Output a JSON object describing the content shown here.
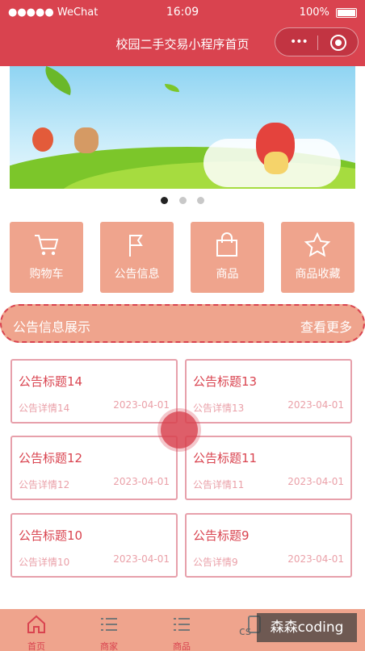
{
  "status": {
    "carrier": "●●●●● WeChat",
    "time": "16:09",
    "battery": "100%"
  },
  "nav": {
    "title": "校园二手交易小程序首页",
    "more_glyph": "•••"
  },
  "banner": {
    "dots": 3,
    "active_dot": 0
  },
  "menu": [
    {
      "label": "购物车",
      "icon": "cart-icon"
    },
    {
      "label": "公告信息",
      "icon": "flag-icon"
    },
    {
      "label": "商品",
      "icon": "bag-icon"
    },
    {
      "label": "商品收藏",
      "icon": "star-icon"
    }
  ],
  "notices_section": {
    "title": "公告信息展示",
    "more": "查看更多"
  },
  "notices": [
    {
      "title": "公告标题14",
      "detail": "公告详情14",
      "date": "2023-04-01"
    },
    {
      "title": "公告标题13",
      "detail": "公告详情13",
      "date": "2023-04-01"
    },
    {
      "title": "公告标题12",
      "detail": "公告详情12",
      "date": "2023-04-01"
    },
    {
      "title": "公告标题11",
      "detail": "公告详情11",
      "date": "2023-04-01"
    },
    {
      "title": "公告标题10",
      "detail": "公告详情10",
      "date": "2023-04-01"
    },
    {
      "title": "公告标题9",
      "detail": "公告详情9",
      "date": "2023-04-01"
    }
  ],
  "tabbar": [
    {
      "label": "首页",
      "icon": "home-icon"
    },
    {
      "label": "商家",
      "icon": "list-icon"
    },
    {
      "label": "商品",
      "icon": "list-icon"
    },
    {
      "label": "",
      "icon": "user-icon"
    }
  ],
  "watermark": {
    "text": "森森coding",
    "prefix": "cs"
  },
  "colors": {
    "primary": "#d9434f",
    "tile": "#efa48d",
    "border": "#e7a0ab"
  }
}
